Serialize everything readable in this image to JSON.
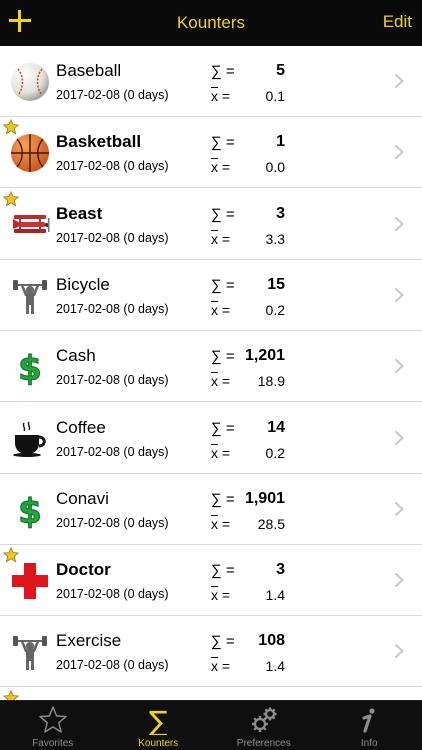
{
  "navbar": {
    "title": "Kounters",
    "edit_label": "Edit",
    "add_icon": "plus-icon"
  },
  "labels": {
    "sum_symbol": "∑ =",
    "avg_symbol": "x",
    "avg_equals": " ="
  },
  "colors": {
    "accent": "#f2d600",
    "nav_bg": "#0a0a0a",
    "star": "#f0c419"
  },
  "counters": [
    {
      "name": "Baseball",
      "date": "2017-02-08 (0 days)",
      "sum": "5",
      "avg": "0.1",
      "favorite": false,
      "bold": false,
      "icon": "baseball-icon"
    },
    {
      "name": "Basketball",
      "date": "2017-02-08 (0 days)",
      "sum": "1",
      "avg": "0.0",
      "favorite": true,
      "bold": true,
      "icon": "basketball-icon"
    },
    {
      "name": "Beast",
      "date": "2017-02-08 (0 days)",
      "sum": "3",
      "avg": "3.3",
      "favorite": true,
      "bold": true,
      "icon": "biplane-icon"
    },
    {
      "name": "Bicycle",
      "date": "2017-02-08 (0 days)",
      "sum": "15",
      "avg": "0.2",
      "favorite": false,
      "bold": false,
      "icon": "weightlifter-icon"
    },
    {
      "name": "Cash",
      "date": "2017-02-08 (0 days)",
      "sum": "1,201",
      "avg": "18.9",
      "favorite": false,
      "bold": false,
      "icon": "dollar-icon"
    },
    {
      "name": "Coffee",
      "date": "2017-02-08 (0 days)",
      "sum": "14",
      "avg": "0.2",
      "favorite": false,
      "bold": false,
      "icon": "coffee-cup-icon"
    },
    {
      "name": "Conavi",
      "date": "2017-02-08 (0 days)",
      "sum": "1,901",
      "avg": "28.5",
      "favorite": false,
      "bold": false,
      "icon": "dollar-icon"
    },
    {
      "name": "Doctor",
      "date": "2017-02-08 (0 days)",
      "sum": "3",
      "avg": "1.4",
      "favorite": true,
      "bold": true,
      "icon": "red-cross-icon"
    },
    {
      "name": "Exercise",
      "date": "2017-02-08 (0 days)",
      "sum": "108",
      "avg": "1.4",
      "favorite": false,
      "bold": false,
      "icon": "weightlifter-icon"
    },
    {
      "name": "",
      "date": "",
      "sum": "",
      "avg": "",
      "favorite": true,
      "bold": false,
      "icon": ""
    }
  ],
  "tabs": [
    {
      "label": "Favorites",
      "icon": "star-outline-icon",
      "active": false
    },
    {
      "label": "Kounters",
      "icon": "sigma-icon",
      "active": true
    },
    {
      "label": "Preferences",
      "icon": "gears-icon",
      "active": false
    },
    {
      "label": "Info",
      "icon": "info-icon",
      "active": false
    }
  ]
}
